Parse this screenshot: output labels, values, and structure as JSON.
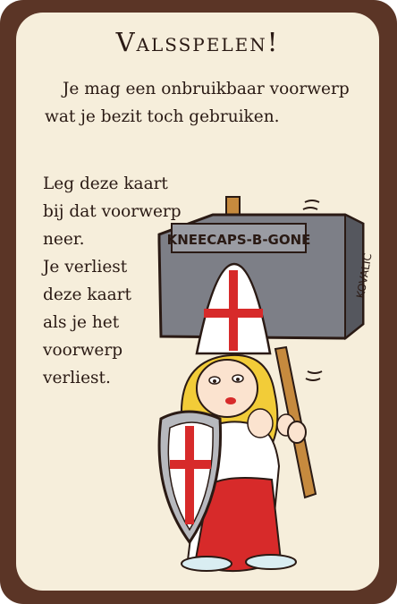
{
  "card": {
    "title": "Valsspelen!",
    "intro_text": "Je mag een onbruikbaar voorwerp wat je bezit toch gebruiken.",
    "rule_lines": [
      "Leg deze kaart",
      "bij dat voorwerp",
      "neer.",
      "Je verliest",
      "deze kaart",
      "als je het",
      "voorwerp",
      "verliest."
    ],
    "illustration": {
      "sign_text": "KNEECAPS-B-GONE",
      "artist_signature": "KOVALIC"
    },
    "colors": {
      "border": "#5b3526",
      "parchment": "#f6eedb",
      "cross_red": "#d72a2a",
      "hammer_gray": "#7d7f87"
    }
  }
}
